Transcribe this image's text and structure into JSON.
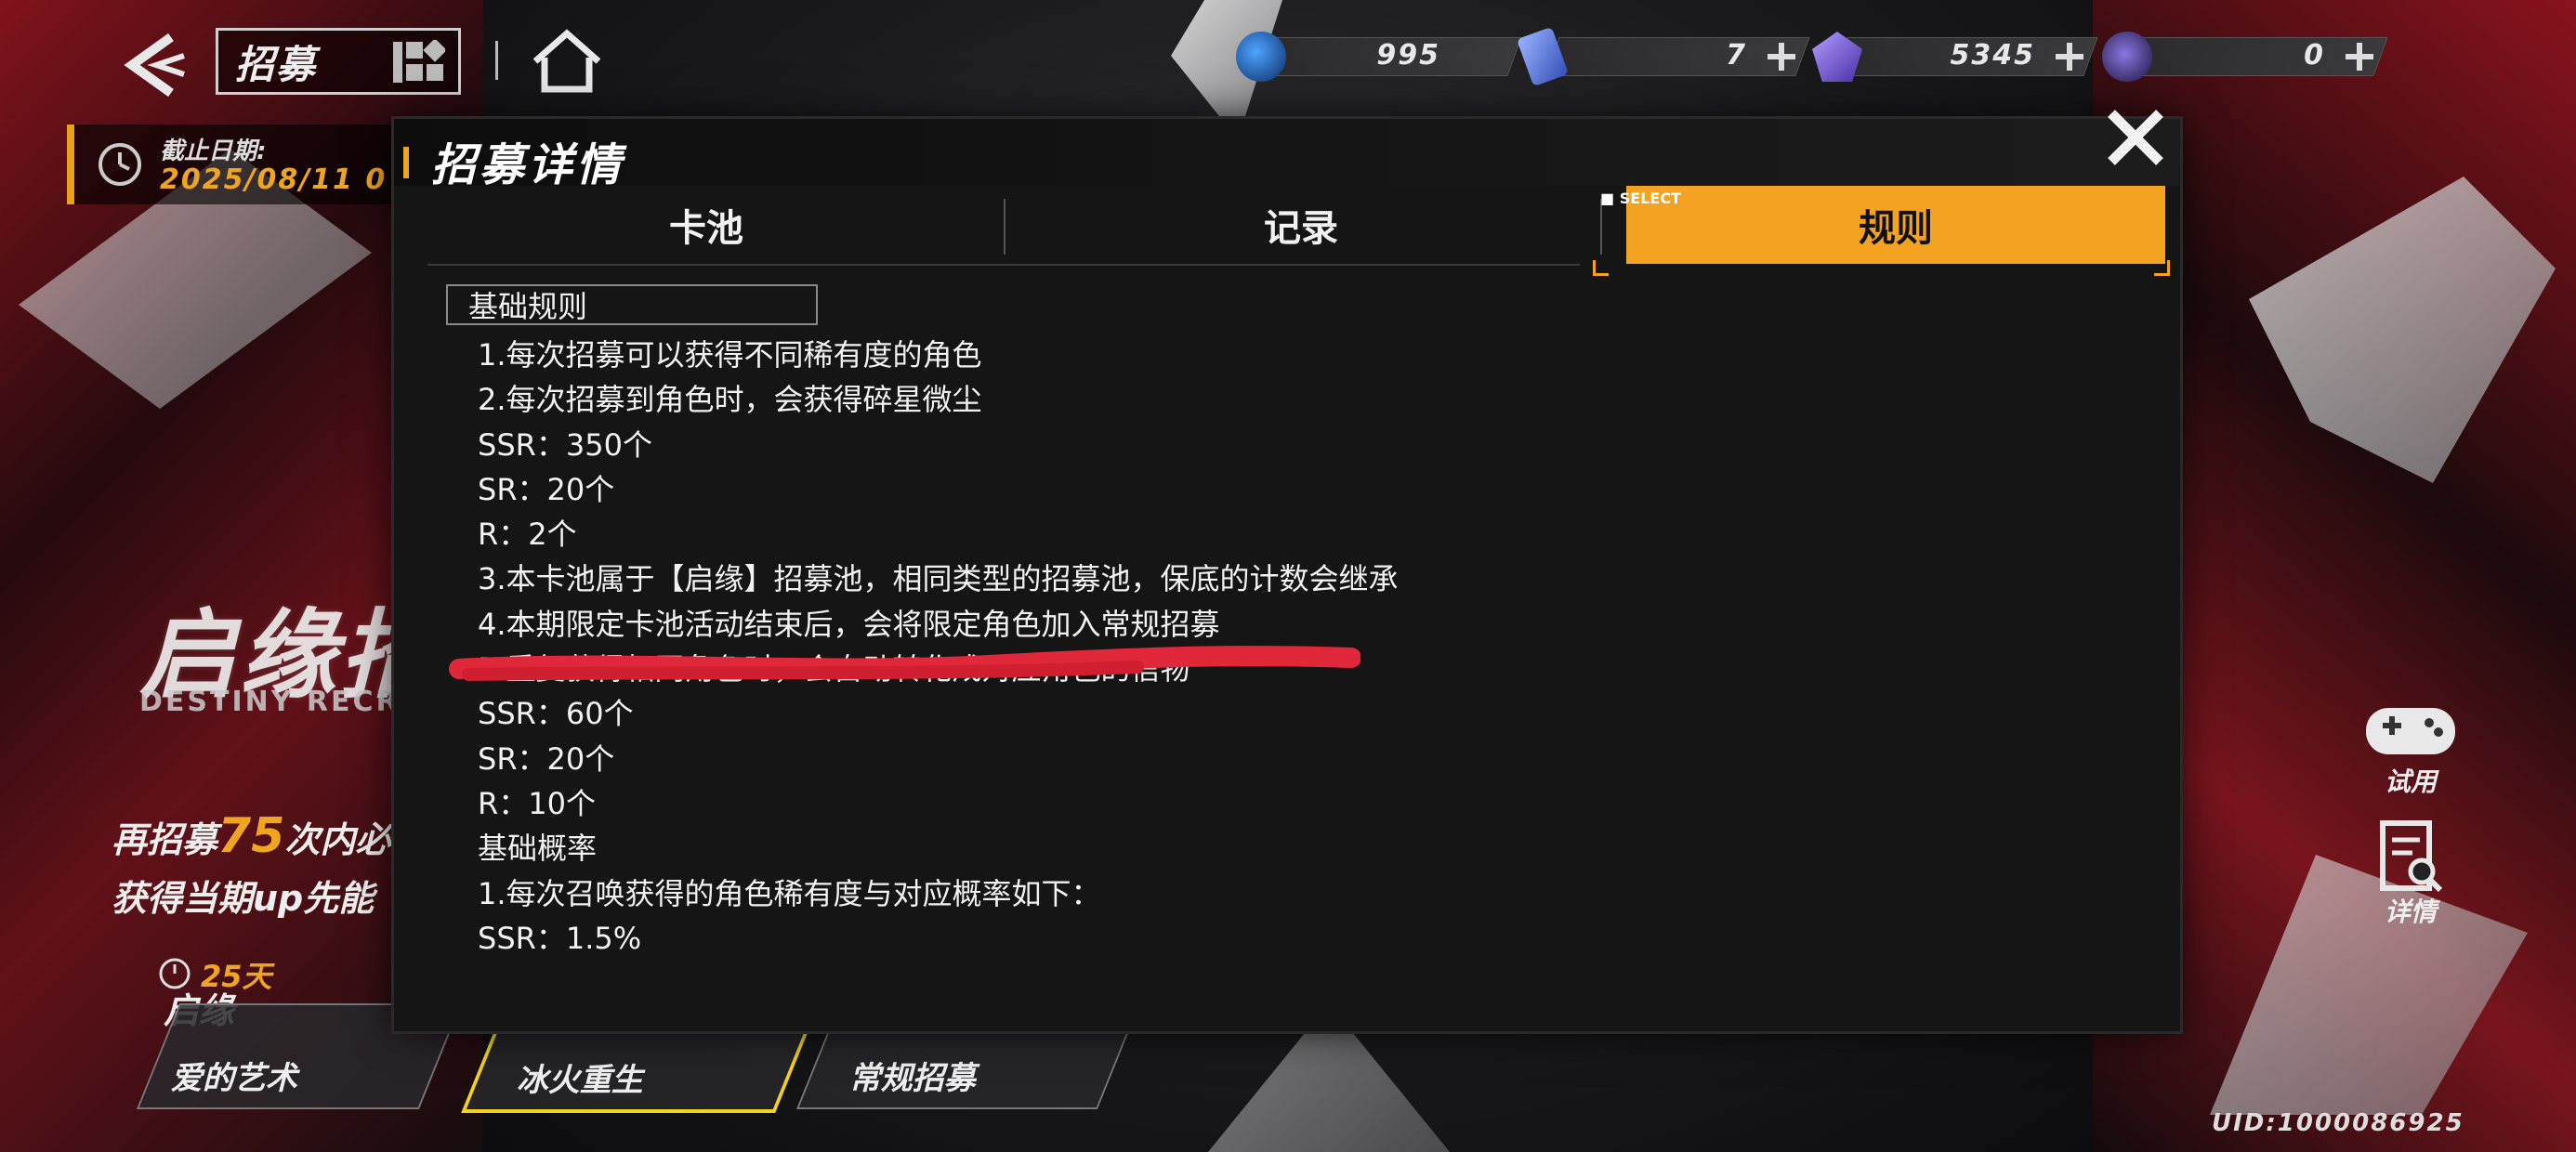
{
  "top_bar": {
    "title": "招募",
    "resources": [
      {
        "name": "blue-orb",
        "value": "995",
        "color": "#1f5fbf"
      },
      {
        "name": "ticket",
        "value": "7",
        "color": "#5a7ad8"
      },
      {
        "name": "crystal",
        "value": "5345",
        "color": "#6a4fd0"
      },
      {
        "name": "dark-orb",
        "value": "0",
        "color": "#4b3aa0"
      }
    ]
  },
  "deadline": {
    "label": "截止日期:",
    "date": "2025/08/11 0"
  },
  "banner": {
    "title": "启缘招募",
    "subtitle": "DESTINY RECRUITME",
    "promo_prefix": "再招募",
    "promo_count": "75",
    "promo_suffix": "次内必",
    "promo_line2": "获得当期up先能"
  },
  "bottom_tabs": {
    "days_left": "25天",
    "qiyuan": "启缘",
    "items": [
      "爱的艺术",
      "冰火重生",
      "常规招募"
    ]
  },
  "side_buttons": {
    "trial": "试用",
    "detail": "详情"
  },
  "uid": "UID:1000086925",
  "modal": {
    "title": "招募详情",
    "tabs": [
      "卡池",
      "记录",
      "规则"
    ],
    "selected_tab": "规则",
    "select_tag": "SELECT",
    "section_title": "基础规则",
    "lines": [
      "1.每次招募可以获得不同稀有度的角色",
      "2.每次招募到角色时，会获得碎星微尘",
      "SSR：350个",
      "SR：20个",
      "R：2个",
      "3.本卡池属于【启缘】招募池，相同类型的招募池，保底的计数会继承",
      "4.本期限定卡池活动结束后，会将限定角色加入常规招募",
      "5.重复获得相同角色时，会自动转化成对应角色的信物",
      "SSR：60个",
      "SR：20个",
      "R：10个",
      "基础概率",
      "1.每次召唤获得的角色稀有度与对应概率如下：",
      "SSR：1.5%"
    ],
    "accent_color": "#f3a321"
  }
}
